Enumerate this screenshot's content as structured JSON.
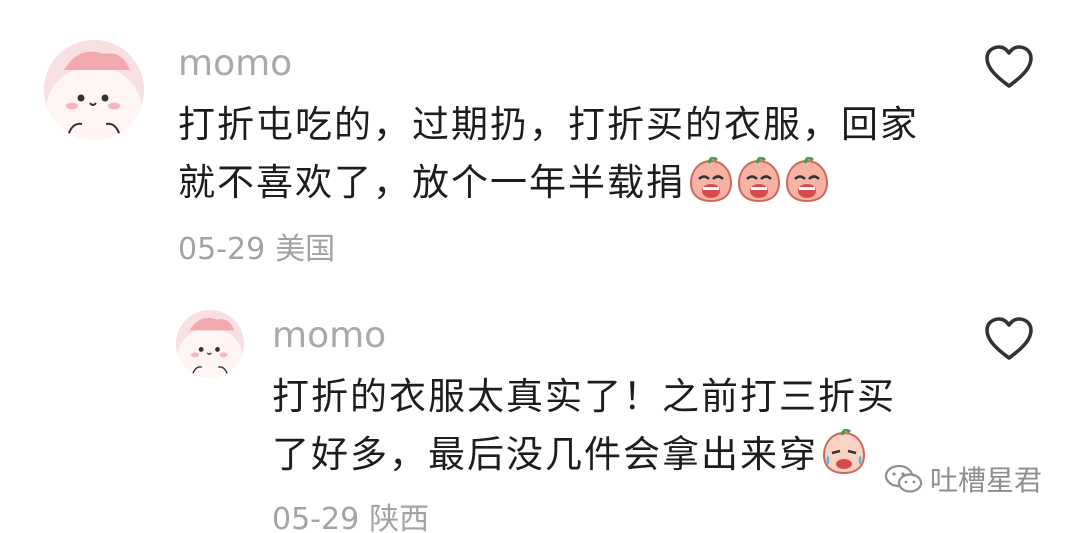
{
  "comments": [
    {
      "username": "momo",
      "lines": [
        "打折屯吃的，过期扔，打折买的衣服，回家",
        "就不喜欢了，放个一年半载捐"
      ],
      "emojis": [
        "crying-face",
        "crying-face",
        "crying-face"
      ],
      "date": "05-29",
      "region": "美国"
    },
    {
      "username": "momo",
      "lines": [
        "打折的衣服太真实了！之前打三折买",
        "了好多，最后没几件会拿出来穿"
      ],
      "emojis": [
        "sweating-face"
      ],
      "date": "05-29",
      "region": "陕西"
    }
  ],
  "watermark": {
    "text": "吐槽星君",
    "icon": "wechat-icon"
  },
  "colors": {
    "username": "#a9a9a9",
    "text": "#1d1d1f",
    "meta": "#a3a3a3",
    "avatar_bg": "#f7dfe2"
  }
}
